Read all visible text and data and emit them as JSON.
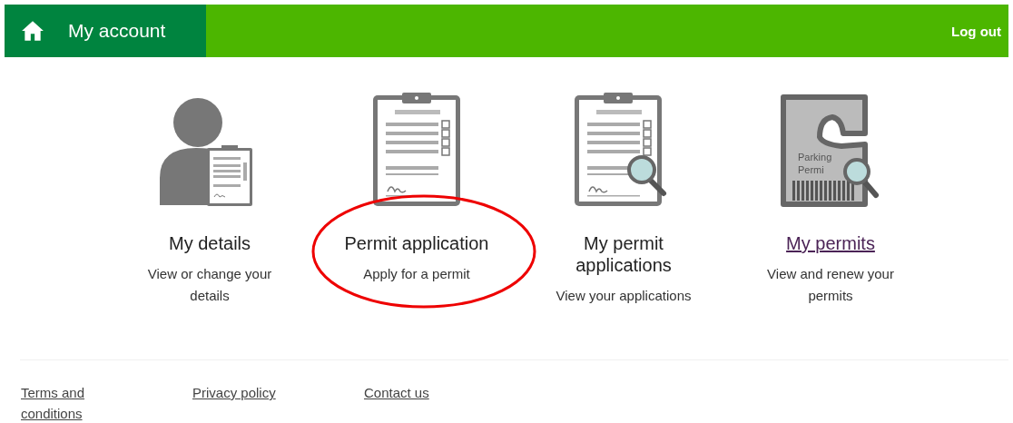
{
  "header": {
    "title": "My account",
    "logout": "Log out"
  },
  "cards": [
    {
      "kind": "person",
      "title": "My details",
      "description": "View or change your details",
      "visited": false,
      "highlighted": false
    },
    {
      "kind": "clipboard",
      "title": "Permit application",
      "description": "Apply for a permit",
      "visited": false,
      "highlighted": true
    },
    {
      "kind": "clipboard-search",
      "title": "My permit applications",
      "description": "View your applications",
      "visited": false,
      "highlighted": false
    },
    {
      "kind": "permit",
      "title": "My permits",
      "description": "View and renew your permits",
      "visited": true,
      "highlighted": false,
      "icon_text": [
        "Parking",
        "Permi"
      ]
    }
  ],
  "footer": {
    "links": [
      "Terms and conditions",
      "Privacy policy",
      "Contact us"
    ]
  }
}
